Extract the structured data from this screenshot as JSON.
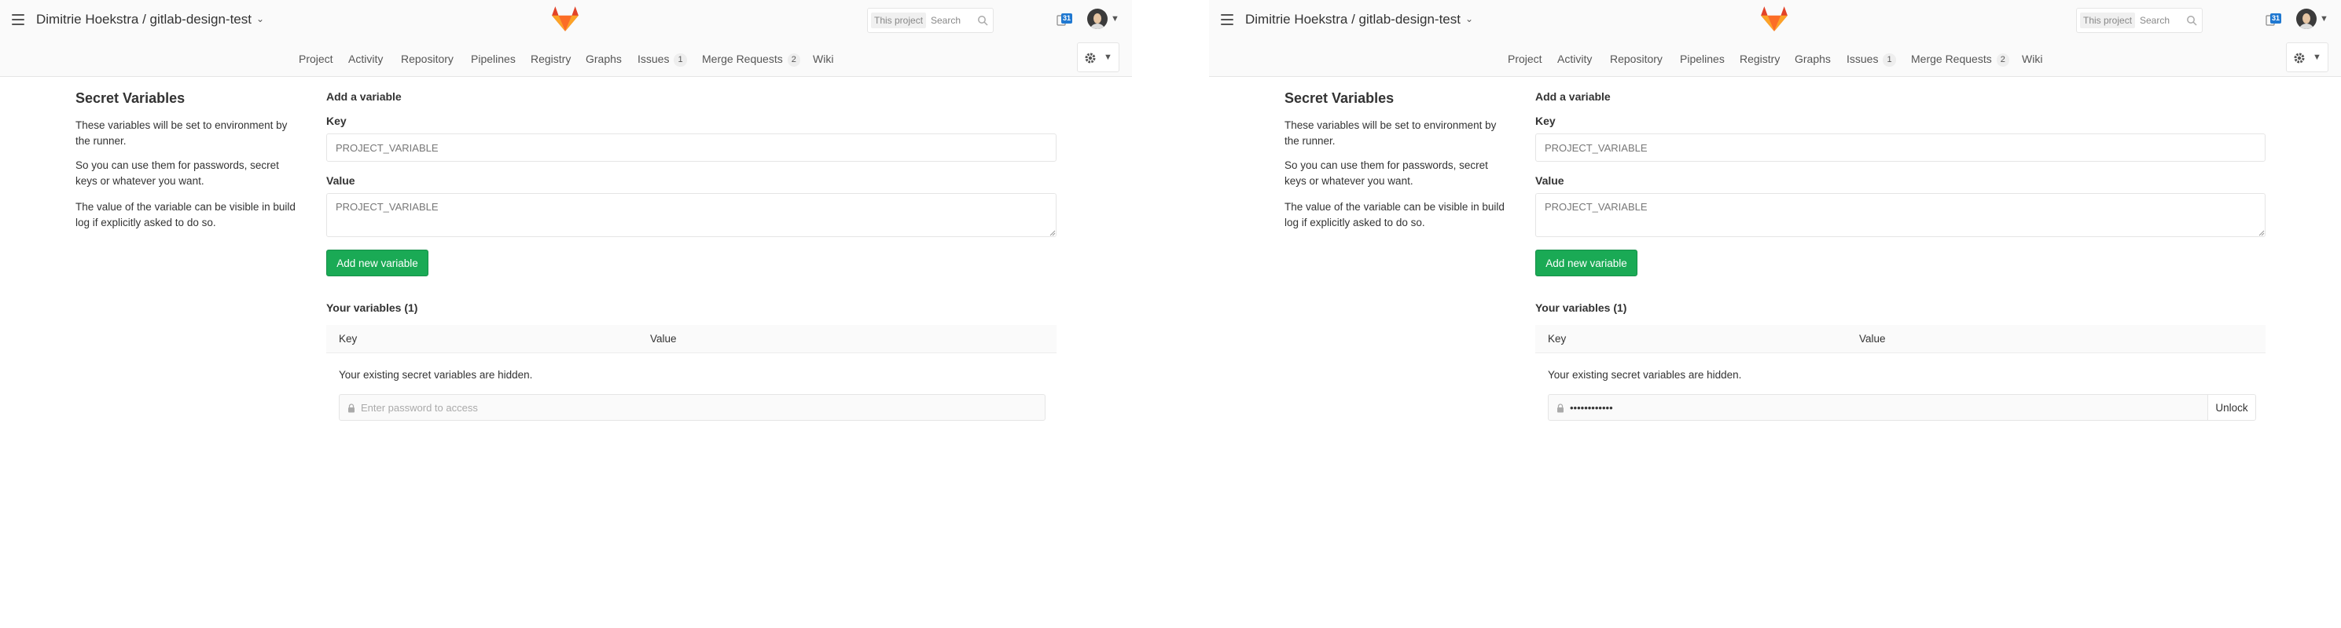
{
  "header": {
    "title": "Dimitrie Hoekstra / gitlab-design-test",
    "search_scope": "This project",
    "search_placeholder": "Search",
    "todos_count": "31"
  },
  "nav": {
    "items": [
      {
        "label": "Project"
      },
      {
        "label": "Activity"
      },
      {
        "label": "Repository"
      },
      {
        "label": "Pipelines"
      },
      {
        "label": "Registry"
      },
      {
        "label": "Graphs"
      },
      {
        "label": "Issues",
        "count": "1"
      },
      {
        "label": "Merge Requests",
        "count": "2"
      },
      {
        "label": "Wiki"
      }
    ]
  },
  "sidebar": {
    "title": "Secret Variables",
    "p1": "These variables will be set to environment by the runner.",
    "p2": "So you can use them for passwords, secret keys or whatever you want.",
    "p3": "The value of the variable can be visible in build log if explicitly asked to do so."
  },
  "form": {
    "heading": "Add a variable",
    "key_label": "Key",
    "key_placeholder": "PROJECT_VARIABLE",
    "value_label": "Value",
    "value_placeholder": "PROJECT_VARIABLE",
    "add_button": "Add new variable"
  },
  "variables": {
    "heading": "Your variables (1)",
    "col_key": "Key",
    "col_value": "Value",
    "hidden_msg": "Your existing secret variables are hidden."
  },
  "left": {
    "password_placeholder": "Enter password to access"
  },
  "right": {
    "password_value": "••••••••••••",
    "unlock_button": "Unlock"
  },
  "colors": {
    "accent_green": "#1aaa55",
    "todo_blue": "#1f78d1"
  }
}
